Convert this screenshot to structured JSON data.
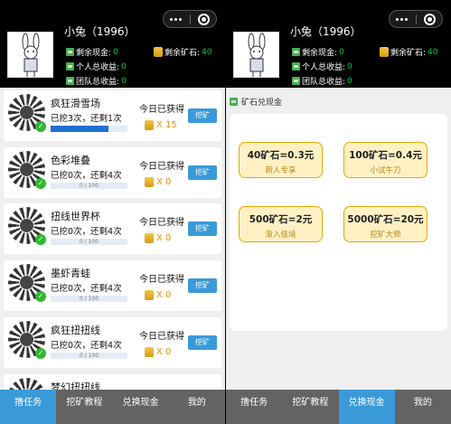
{
  "user": {
    "name": "小兔（1996）",
    "remaining_cash_label": "剩余现金:",
    "remaining_cash": "0",
    "remaining_ore_label": "剩余矿石:",
    "remaining_ore": "40",
    "personal_income_label": "个人总收益:",
    "personal_income": "0",
    "team_income_label": "团队总收益:",
    "team_income": "0"
  },
  "games": [
    {
      "name": "疯狂滑雪场",
      "progress": "已挖3次，还剩1次",
      "bar_fraction": 0.75,
      "bar_text": "",
      "today": "今日已获得",
      "earned": "X 15",
      "button": "挖矿"
    },
    {
      "name": "色彩堆叠",
      "progress": "已挖0次，还剩4次",
      "bar_fraction": 0,
      "bar_text": "0 / 100",
      "today": "今日已获得",
      "earned": "X 0",
      "button": "挖矿"
    },
    {
      "name": "扭线世界杯",
      "progress": "已挖0次，还剩4次",
      "bar_fraction": 0,
      "bar_text": "0 / 100",
      "today": "今日已获得",
      "earned": "X 0",
      "button": "挖矿"
    },
    {
      "name": "墨虾青蛙",
      "progress": "已挖0次，还剩4次",
      "bar_fraction": 0,
      "bar_text": "0 / 100",
      "today": "今日已获得",
      "earned": "X 0",
      "button": "挖矿"
    },
    {
      "name": "疯狂扭扭线",
      "progress": "已挖0次，还剩4次",
      "bar_fraction": 0,
      "bar_text": "0 / 100",
      "today": "今日已获得",
      "earned": "X 0",
      "button": "挖矿"
    },
    {
      "name": "梦幻扭扭线",
      "progress": "",
      "bar_fraction": 0,
      "bar_text": "",
      "today": "",
      "earned": "",
      "button": ""
    }
  ],
  "nav_left": [
    "撸任务",
    "挖矿教程",
    "兑换现金",
    "我的"
  ],
  "nav_right": [
    "撸任务",
    "挖矿教程",
    "兑换现金",
    "我的"
  ],
  "exchange": {
    "title": "矿石兑现金",
    "options": [
      {
        "rate": "40矿石=0.3元",
        "name": "新人专享"
      },
      {
        "rate": "100矿石=0.4元",
        "name": "小试牛刀"
      },
      {
        "rate": "500矿石=2元",
        "name": "渐入佳境"
      },
      {
        "rate": "5000矿石=20元",
        "name": "挖矿大师"
      }
    ]
  },
  "colors": {
    "accent": "#3a9ad9",
    "earn": "#f08c00",
    "stat_green": "#00c853",
    "nav_bg": "#636363"
  },
  "icons": {
    "avatar": "rabbit-avatar",
    "coin": "coin-stack-icon",
    "stat": "wallet-icon"
  }
}
